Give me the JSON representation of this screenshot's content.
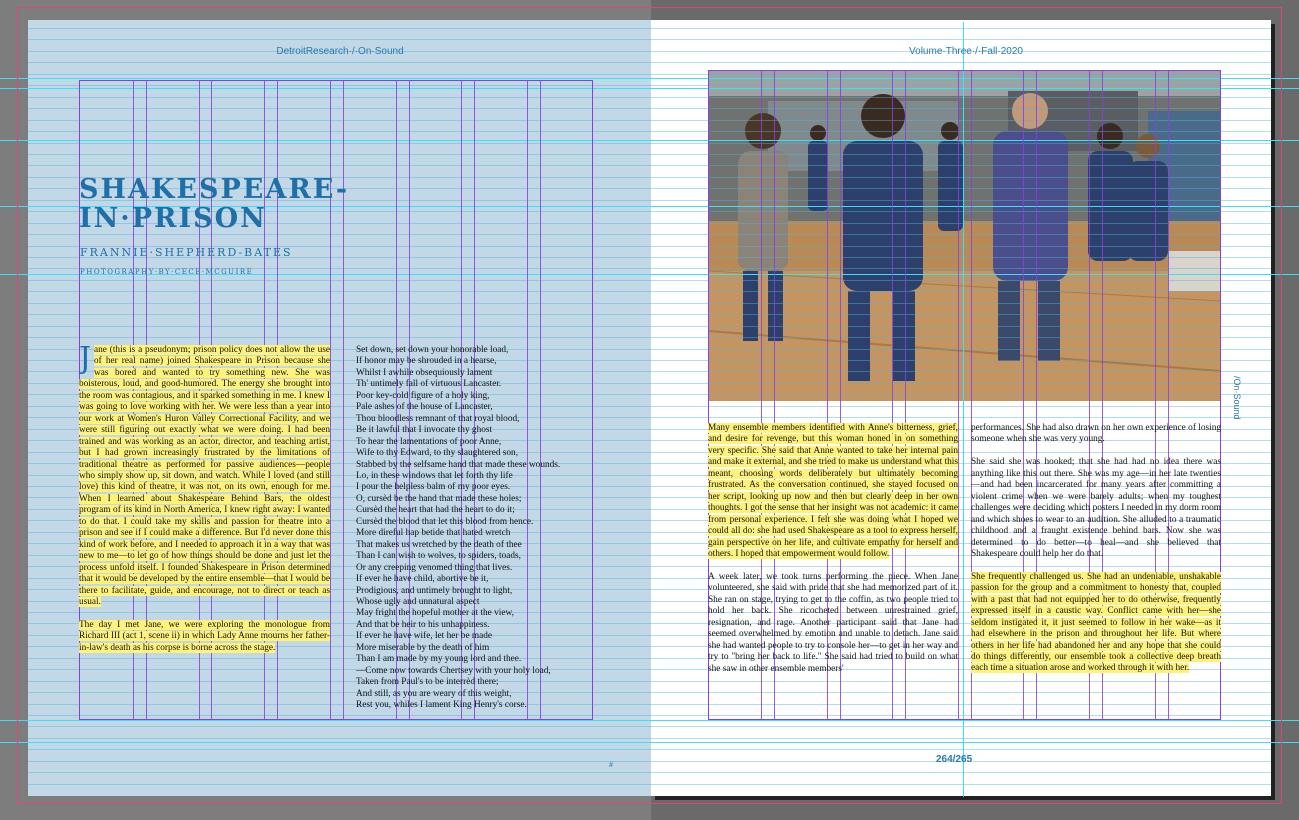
{
  "spread": {
    "left_running_head": "DetroitResearch·/·On·Sound",
    "right_running_head": "Volume·Three·/·Fall·2020",
    "folio": "264/265",
    "side_tab": "/On·Sound",
    "pilcrow": "#"
  },
  "article": {
    "title_line1": "SHAKESPEARE-",
    "title_line2": "IN·PRISON",
    "author": "FRANNIE·SHEPHERD-BATES",
    "photo_credit": "PHOTOGRAPHY·BY·CECE·MCGUIRE",
    "dropcap": "J",
    "col1_p1": "ane (this is a pseudonym; prison policy does not allow the use of her real name) joined Shakespeare in Prison because she was bored and wanted to try something new. She was boisterous, loud, and good-humored. The energy she brought into the room was contagious, and it sparked something in me. I knew I was going to love working with her. We were less than a year into our work at Women's Huron Valley Correctional Facility, and we were still figuring out exactly what we were doing. I had been trained and was working as an actor, director, and teaching artist, but I had grown increasingly frustrated by the limitations of traditional theatre as performed for passive audiences—people who simply show up, sit down, and watch. While I loved (and still love) this kind of theatre, it was not, on its own, enough for me. When I learned about Shakespeare Behind Bars, the oldest program of its kind in North America, I knew right away: I wanted to do that. I could take my skills and passion for theatre into a prison and see if I could make a difference. But I'd never done this kind of work before, and I needed to approach it in a way that was new to me—to let go of how things should be done and just let the process unfold itself. I founded Shakespeare in Prison determined that it would be developed by the entire ensemble—that I would be there to facilitate, guide, and encourage, not to direct or teach as usual.",
    "col1_p2": "The day I met Jane, we were exploring the monologue from Richard III (act 1, scene ii) in which Lady Anne mourns her father-in-law's death as his corpse is borne across the stage.",
    "poem": [
      "Set down, set down your honorable load,",
      "If honor may be shrouded in a hearse,",
      "Whilst I awhile obsequiously lament",
      "Th' untimely fall of virtuous Lancaster.",
      "Poor key-cold figure of a holy king,",
      "Pale ashes of the house of Lancaster,",
      "Thou bloodless remnant of that royal blood,",
      "Be it lawful that I invocate thy ghost",
      "To hear the lamentations of poor Anne,",
      "Wife to thy Edward, to thy slaughtered son,",
      "Stabbed by the selfsame hand that made these wounds.",
      "Lo, in these windows that let forth thy life",
      "I pour the helpless balm of my poor eyes.",
      "O, cursèd be the hand that made these holes;",
      "Cursèd the heart that had the heart to do it;",
      "Cursèd the blood that let this blood from hence.",
      "More direful hap betide that hated wretch",
      "That makes us wretched by the death of thee",
      "Than I can wish to wolves, to spiders, toads,",
      "Or any creeping venomed thing that lives.",
      "If ever he have child, abortive be it,",
      "Prodigious, and untimely brought to light,",
      "Whose ugly and unnatural aspect",
      "May fright the hopeful mother at the view,",
      "And that be heir to his unhappiness.",
      "If ever he have wife, let her be made",
      "More miserable by the death of him",
      "Than I am made by my young lord and thee.",
      "—Come now towards Chertsey with your holy load,",
      "Taken from Paul's to be interrèd there;",
      "And still, as you are weary of this weight,",
      "Rest you, whiles I lament King Henry's corse."
    ],
    "col3_p1": "Many ensemble members identified with Anne's bitterness, grief, and desire for revenge, but this woman honed in on something very specific. She said that Anne wanted to take her internal pain and make it external, and she tried to make us understand what this meant, choosing words deliberately but ultimately becoming frustrated. As the conversation continued, she stayed focused on her script, looking up now and then but clearly deep in her own thoughts. I got the sense that her insight was not academic: it came from personal experience. I felt she was doing what I hoped we could all do: she had used Shakespeare as a tool to express herself, gain perspective on her life, and cultivate empathy for herself and others. I hoped that empowerment would follow.",
    "col3_p2": "A week later, we took turns performing the piece. When Jane volunteered, she said with pride that she had memorized part of it. She ran on stage, trying to get to the coffin, as two people tried to hold her back. She ricocheted between unrestrained grief, resignation, and rage. Another participant said that Jane had seemed overwhelmed by emotion and unable to detach. Jane said she had wanted people to try to console her—to get in her way and try to \"bring her back to life.\" She said had tried to build on what she saw in other ensemble members'",
    "col4_p1": "performances. She had also drawn on her own experience of losing someone when she was very young.",
    "col4_p2": "She said she was hooked; that she had had no idea there was anything like this out there. She was my age—in her late twenties—and had been incarcerated for many years after committing a violent crime when we were barely adults; when my toughest challenges were deciding which posters I needed in my dorm room and which shoes to wear to an audition. She alluded to a traumatic childhood and a fraught existence behind bars. Now she was determined to do better—to heal—and she believed that Shakespeare could help her do that.",
    "col4_p3": "She frequently challenged us. She had an undeniable, unshakable passion for the group and a commitment to honesty that, coupled with a past that had not equipped her to do otherwise, frequently expressed itself in a caustic way. Conflict came with her—she seldom instigated it, it just seemed to follow in her wake—as it had elsewhere in the prison and throughout her life. But where others in her life had abandoned her and any hope that she could do things differently, our ensemble took a collective deep breath each time a situation arose and worked through it with her."
  },
  "colors": {
    "left_page": "#c3d8e7",
    "right_page": "#ffffff",
    "accent": "#1f6fa8",
    "highlight": "#fff27a",
    "guide": "#38e0ff",
    "column_guide": "#8a3fe0",
    "bleed": "#e0457a"
  }
}
